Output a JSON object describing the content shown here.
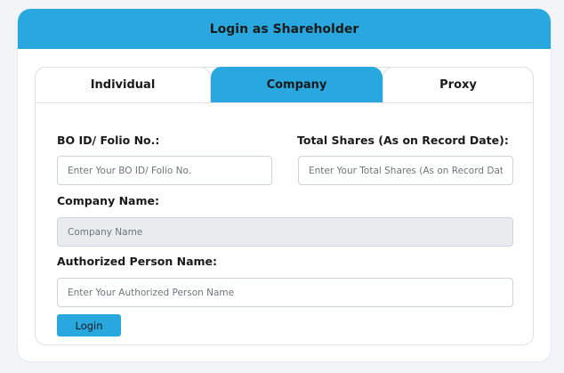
{
  "header": {
    "title": "Login as Shareholder"
  },
  "tabs": [
    {
      "label": "Individual",
      "active": false
    },
    {
      "label": "Company",
      "active": true
    },
    {
      "label": "Proxy",
      "active": false
    }
  ],
  "form": {
    "bo_id": {
      "label": "BO ID/ Folio No.:",
      "placeholder": "Enter Your BO ID/ Folio No.",
      "value": ""
    },
    "total_shares": {
      "label": "Total Shares (As on Record Date):",
      "placeholder": "Enter Your Total Shares (As on Record Date)",
      "value": ""
    },
    "company_name": {
      "label": "Company Name:",
      "placeholder": "Company Name",
      "value": "",
      "disabled": true
    },
    "authorized_person": {
      "label": "Authorized Person Name:",
      "placeholder": "Enter Your Authorized Person Name",
      "value": ""
    },
    "login_label": "Login"
  },
  "colors": {
    "accent": "#29a8e0",
    "background": "#f3f4f8",
    "disabled_field": "#e9ecef"
  }
}
